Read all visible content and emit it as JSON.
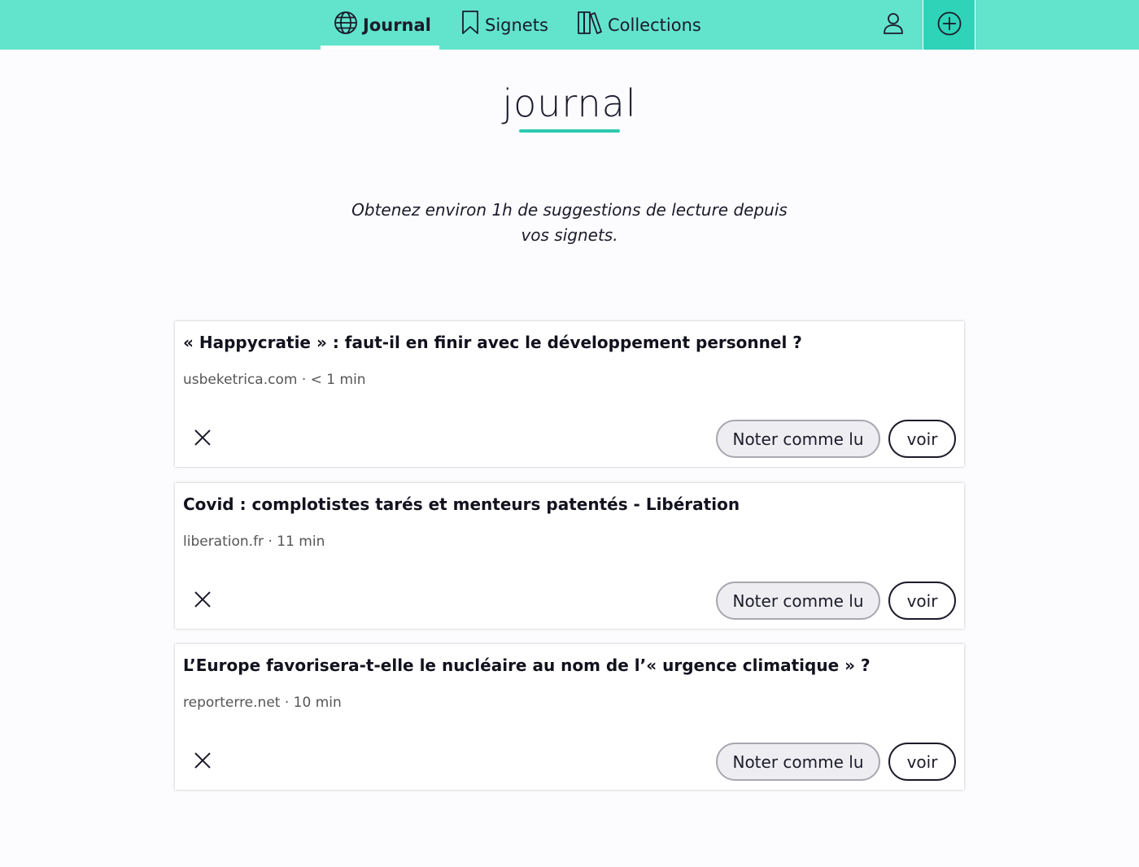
{
  "nav": {
    "journal_label": "Journal",
    "signets_label": "Signets",
    "collections_label": "Collections"
  },
  "header": {
    "logo_text": "journal",
    "subtitle": "Obtenez environ 1h de suggestions de lecture depuis vos signets."
  },
  "colors": {
    "topbar": "#62e3cc",
    "add_button": "#2fd3b8",
    "accent": "#2ccbb0"
  },
  "icons": {
    "journal": "globe-icon",
    "signets": "bookmark-icon",
    "collections": "books-icon",
    "profile": "user-icon",
    "add": "plus-circle-icon",
    "dismiss": "close-icon"
  },
  "articles": [
    {
      "title": "« Happycratie » : faut-il en finir avec le développement personnel ?",
      "meta": "usbeketrica.com · < 1 min",
      "read_label": "Noter comme lu",
      "view_label": "voir"
    },
    {
      "title": "Covid : complotistes tarés et menteurs patentés - Libération",
      "meta": "liberation.fr · 11 min",
      "read_label": "Noter comme lu",
      "view_label": "voir"
    },
    {
      "title": "L’Europe favorisera-t-elle le nucléaire au nom de l’« urgence climatique » ?",
      "meta": "reporterre.net · 10 min",
      "read_label": "Noter comme lu",
      "view_label": "voir"
    }
  ]
}
